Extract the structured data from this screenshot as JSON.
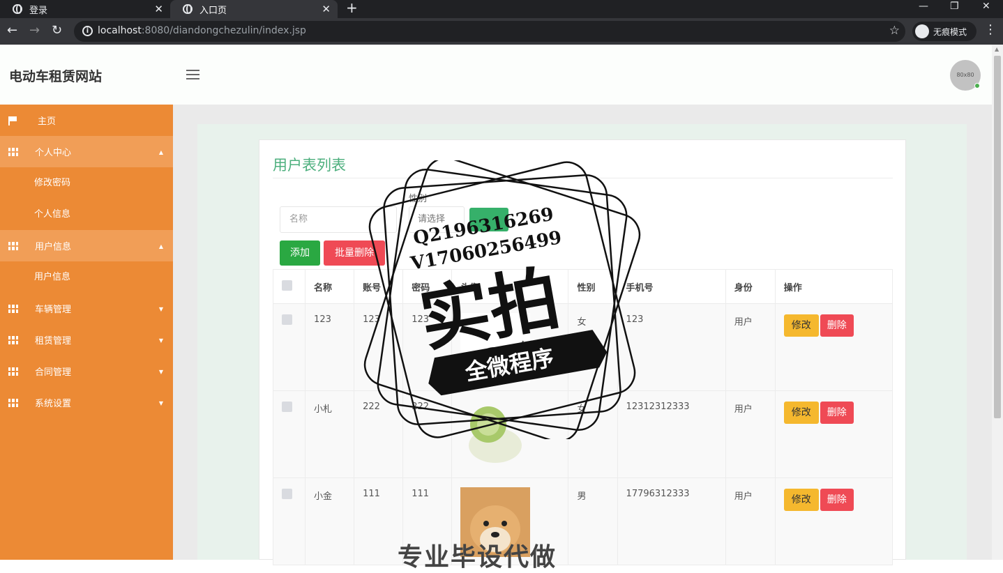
{
  "browser": {
    "tabs": [
      {
        "title": "登录",
        "active": false
      },
      {
        "title": "入口页",
        "active": true
      }
    ],
    "url_host": "localhost",
    "url_rest": ":8080/diandongchezulin/index.jsp",
    "incognito_label": "无痕模式"
  },
  "header": {
    "brand": "电动车租赁网站",
    "avatar_text": "80x80"
  },
  "sidebar": {
    "items": [
      {
        "label": "主页",
        "icon": "flag-icon"
      },
      {
        "label": "个人中心",
        "icon": "grid-icon",
        "caret": "▲"
      },
      {
        "label": "修改密码"
      },
      {
        "label": "个人信息"
      },
      {
        "label": "用户信息",
        "icon": "grid-icon",
        "caret": "▲"
      },
      {
        "label": "用户信息"
      },
      {
        "label": "车辆管理",
        "icon": "grid-icon",
        "caret": "▼"
      },
      {
        "label": "租赁管理",
        "icon": "grid-icon",
        "caret": "▼"
      },
      {
        "label": "合同管理",
        "icon": "grid-icon",
        "caret": "▼"
      },
      {
        "label": "系统设置",
        "icon": "grid-icon",
        "caret": "▼"
      }
    ]
  },
  "main": {
    "title": "用户表列表",
    "search": {
      "name_placeholder": "名称",
      "gender_label": "性别",
      "gender_placeholder": "请选择"
    },
    "buttons": {
      "add": "添加",
      "batch_delete": "批量删除",
      "edit": "修改",
      "delete": "删除"
    },
    "table": {
      "headers": [
        "名称",
        "账号",
        "密码",
        "头像",
        "性别",
        "手机号",
        "身份",
        "操作"
      ],
      "rows": [
        {
          "name": "123",
          "account": "123",
          "password": "123",
          "gender": "女",
          "phone": "123",
          "role": "用户"
        },
        {
          "name": "小札",
          "account": "222",
          "password": "222",
          "gender": "女",
          "phone": "12312312333",
          "role": "用户"
        },
        {
          "name": "小金",
          "account": "111",
          "password": "111",
          "gender": "男",
          "phone": "17796312333",
          "role": "用户"
        }
      ]
    }
  },
  "watermark": {
    "line1": "Q2196316269",
    "line2": "V17060256499",
    "big": "实拍",
    "ribbon": "全微程序",
    "bottom": "专业毕设代做"
  },
  "colors": {
    "sidebar": "#ec8a35",
    "title": "#4caf7d",
    "add": "#2aa842",
    "delete": "#ef4a55",
    "edit": "#f5b82e"
  }
}
